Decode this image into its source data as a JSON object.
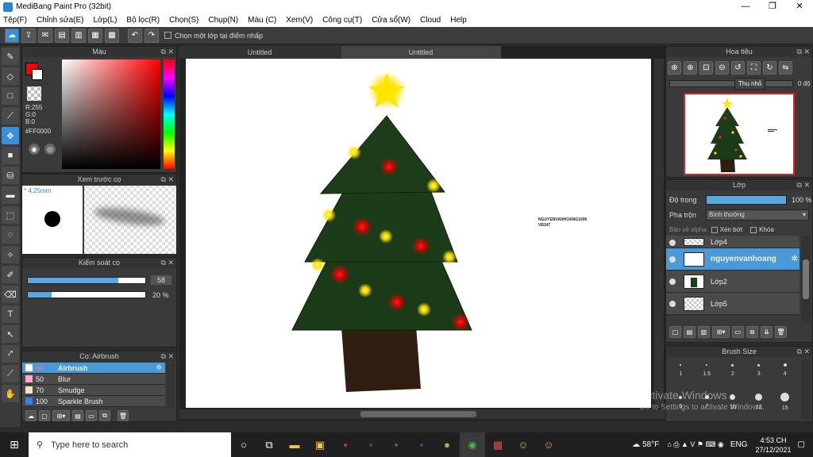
{
  "window": {
    "title": "MediBang Paint Pro (32bit)",
    "minimize": "—",
    "maximize": "❐",
    "close": "✕"
  },
  "menu": [
    "Tệp(F)",
    "Chỉnh sửa(E)",
    "Lớp(L)",
    "Bộ lọc(R)",
    "Chọn(S)",
    "Chụp(N)",
    "Màu (C)",
    "Xem(V)",
    "Công cụ(T)",
    "Cửa sổ(W)",
    "Cloud",
    "Help"
  ],
  "toolbar": {
    "checkbox_label": "Chọn một lớp tại điểm nhấp"
  },
  "color_panel": {
    "title": "Màu",
    "r": "R:255",
    "g": "G:0",
    "b": "B:0",
    "hex": "#FF0000",
    "primary_color": "#FF0000"
  },
  "brush_preview": {
    "title": "Xem trước cọ",
    "size": "* 4.25mm"
  },
  "brush_control": {
    "title": "Kiểm soát cọ",
    "size_value": "58",
    "opacity_value": "20 %",
    "size_fraction": 0.77,
    "opacity_fraction": 0.2
  },
  "brush_list": {
    "title": "Cọ: Airbrush",
    "items": [
      {
        "size": "58",
        "name": "Airbrush",
        "color": "#ffffff"
      },
      {
        "size": "50",
        "name": "Blur",
        "color": "#f7a8d8"
      },
      {
        "size": "70",
        "name": "Smudge",
        "color": "#f5e6c0"
      },
      {
        "size": "100",
        "name": "Sparkle Brush",
        "color": "#3a7fd8"
      }
    ]
  },
  "tabs": [
    "Untitled",
    "Untitled"
  ],
  "canvas": {
    "signature_line1": "NGUYENVANHOANG1606",
    "signature_line2": "VĐ247"
  },
  "navigator": {
    "title": "Hoa tiêu",
    "tooltip": "Thu nhỏ",
    "angle": "0 độ"
  },
  "layers": {
    "title": "Lớp",
    "opacity_label": "Độ trong",
    "opacity_value": "100 %",
    "blend_label": "Pha trộn",
    "blend_value": "Bình thường",
    "protect_alpha": "Bảo vệ alpha",
    "clipping": "Xén bớt",
    "lock": "Khóa",
    "items": [
      "Lớp4",
      "nguyenvanhoang",
      "Lớp2",
      "Lớp5"
    ]
  },
  "brush_size": {
    "title": "Brush Size",
    "sizes": [
      "1",
      "1.5",
      "2",
      "3",
      "4",
      "5",
      "7",
      "10",
      "12",
      "15"
    ]
  },
  "activation": {
    "line1": "Activate Windows",
    "line2": "Go to Settings to activate Windows."
  },
  "taskbar": {
    "search_placeholder": "Type here to search",
    "weather": "58°F",
    "lang": "ENG",
    "time": "4:53 CH",
    "date": "27/12/2021"
  }
}
